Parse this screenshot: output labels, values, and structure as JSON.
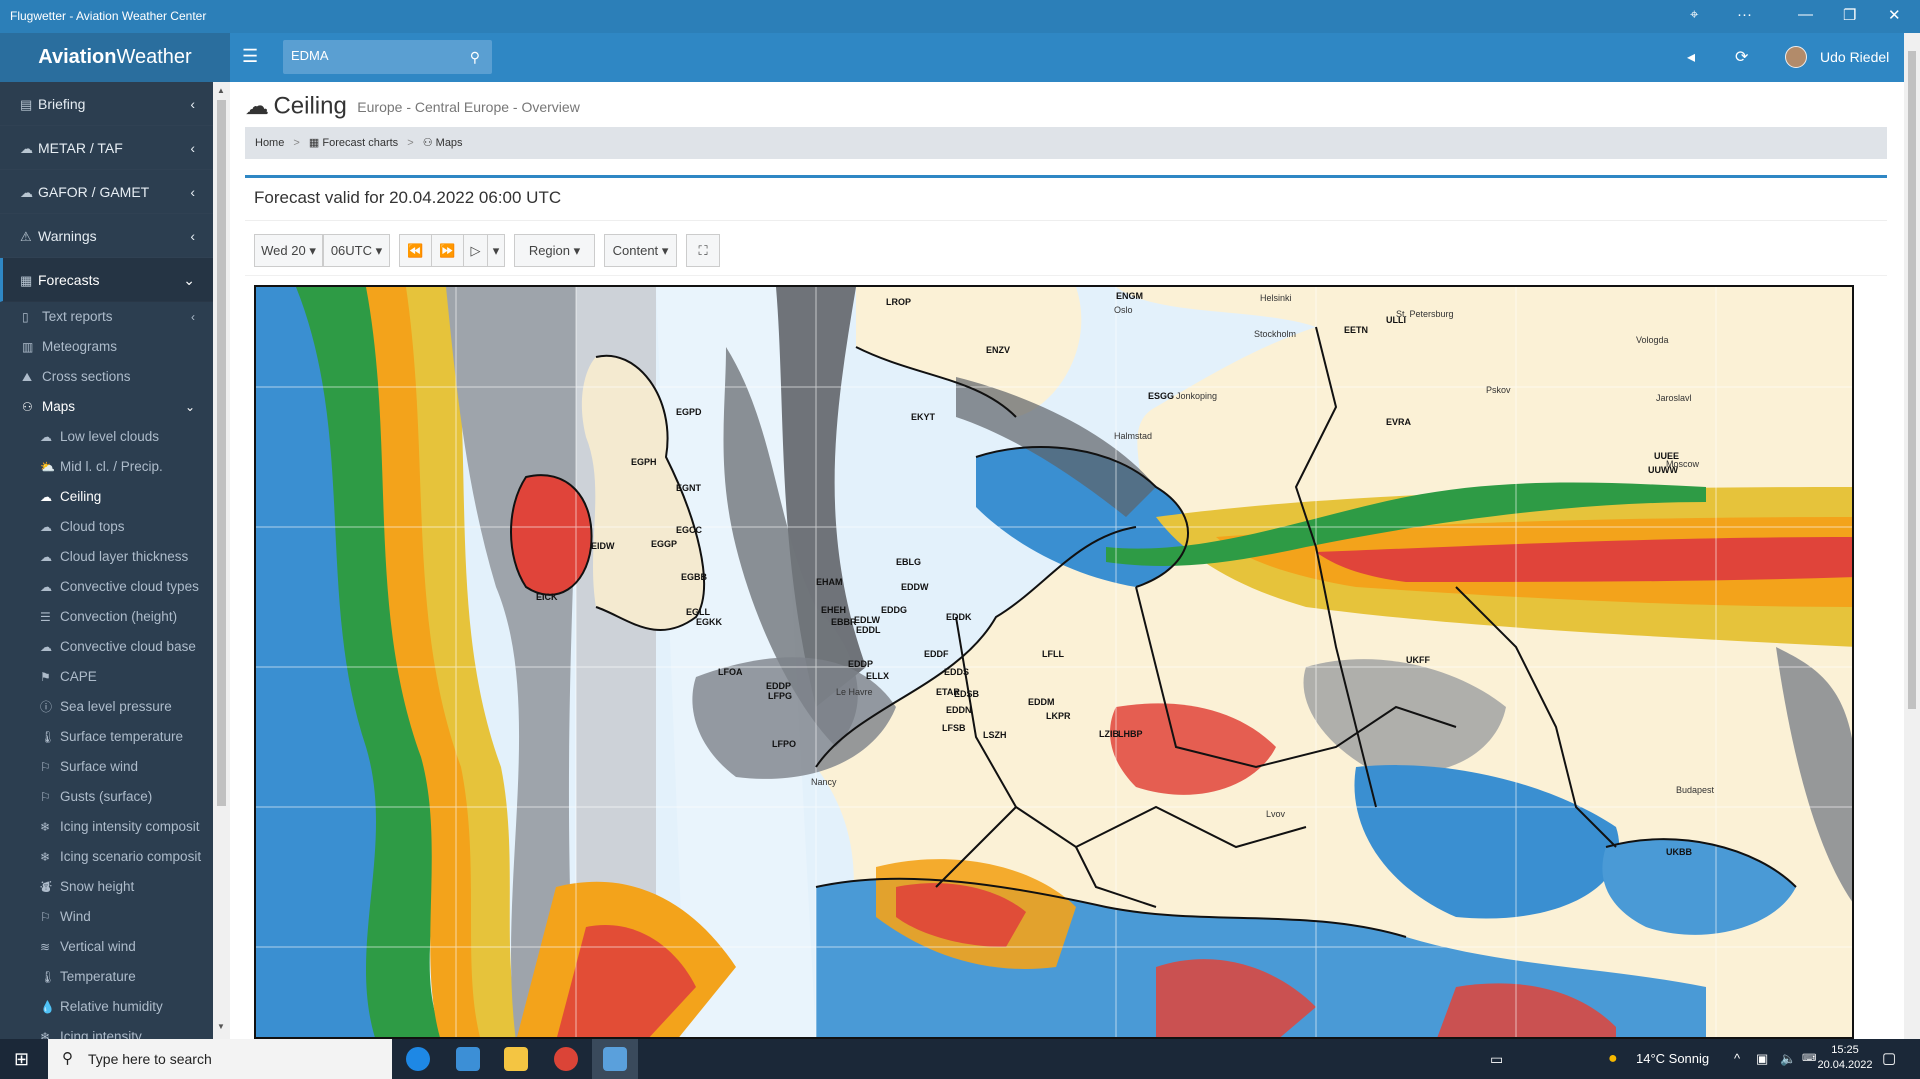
{
  "window": {
    "title": "Flugwetter - Aviation Weather Center"
  },
  "header": {
    "logo_bold": "Aviation",
    "logo_rest": "Weather",
    "search_value": "EDMA",
    "user_name": "Udo Riedel"
  },
  "sidebar": {
    "top_items": [
      {
        "label": "Briefing",
        "icon": "file-icon"
      },
      {
        "label": "METAR / TAF",
        "icon": "cloud-icon"
      },
      {
        "label": "GAFOR / GAMET",
        "icon": "cloud-icon"
      },
      {
        "label": "Warnings",
        "icon": "warning-icon"
      }
    ],
    "forecasts_label": "Forecasts",
    "sub_items": [
      {
        "label": "Text reports",
        "icon": "doc-icon"
      },
      {
        "label": "Meteograms",
        "icon": "chart-icon"
      },
      {
        "label": "Cross sections",
        "icon": "mountain-icon"
      }
    ],
    "maps_label": "Maps",
    "map_items": [
      {
        "label": "Low level clouds"
      },
      {
        "label": "Mid l. cl. / Precip."
      },
      {
        "label": "Ceiling"
      },
      {
        "label": "Cloud tops"
      },
      {
        "label": "Cloud layer thickness"
      },
      {
        "label": "Convective cloud types"
      },
      {
        "label": "Convection (height)"
      },
      {
        "label": "Convective cloud base"
      },
      {
        "label": "CAPE"
      },
      {
        "label": "Sea level pressure"
      },
      {
        "label": "Surface temperature"
      },
      {
        "label": "Surface wind"
      },
      {
        "label": "Gusts (surface)"
      },
      {
        "label": "Icing intensity composit"
      },
      {
        "label": "Icing scenario composit"
      },
      {
        "label": "Snow height"
      },
      {
        "label": "Wind"
      },
      {
        "label": "Vertical wind"
      },
      {
        "label": "Temperature"
      },
      {
        "label": "Relative humidity"
      },
      {
        "label": "Icing intensity"
      }
    ]
  },
  "page": {
    "title": "Ceiling",
    "subtitle": "Europe - Central Europe - Overview",
    "breadcrumb": [
      "Home",
      "Forecast charts",
      "Maps"
    ]
  },
  "panel": {
    "title": "Forecast valid for 20.04.2022 06:00 UTC",
    "day_select": "Wed 20",
    "time_select": "06UTC",
    "region_label": "Region",
    "content_label": "Content"
  },
  "map_labels": [
    "ENGM",
    "Oslo",
    "ENZV",
    "ESGG",
    "Jonkoping",
    "Halmstad",
    "Stockholm",
    "Helsinki",
    "EETN",
    "St. Petersburg",
    "ULLI",
    "Vologda",
    "Pskov",
    "EVRA",
    "Jaroslavl",
    "UUEE",
    "UUWW",
    "Moscow",
    "EGPD",
    "EGPH",
    "EGNT",
    "EGCC",
    "EGGP",
    "EGBB",
    "EGLL",
    "EGKK",
    "EIDW",
    "EICK",
    "EKYT",
    "EHAM",
    "EHEH",
    "EBBR",
    "EBLG",
    "EDDW",
    "EDDG",
    "EDLW",
    "EDDL",
    "EDDK",
    "EDDF",
    "EDDP",
    "ELLX",
    "ETAR",
    "EDSB",
    "EDDS",
    "EDDN",
    "EDDM",
    "LFSB",
    "LSZH",
    "EDDP",
    "LFPG",
    "LFPO",
    "LFOA",
    "Le Havre",
    "Nancy",
    "LFLL",
    "LKPR",
    "LZIB",
    "LHBP",
    "Budapest",
    "UKBB",
    "UKFF",
    "Lvov",
    "LROP"
  ],
  "taskbar": {
    "search_placeholder": "Type here to search",
    "weather": "14°C  Sonnig",
    "time": "15:25",
    "date": "20.04.2022"
  }
}
